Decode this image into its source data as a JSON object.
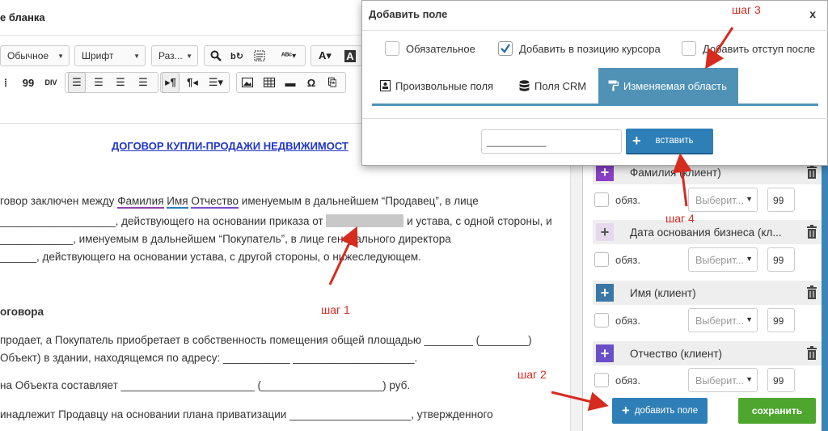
{
  "editor": {
    "title": "е бланка",
    "toolbar": {
      "style_select": "Обычное",
      "font_select": "Шрифт",
      "size_select": "Раз..."
    },
    "document": {
      "heading": "ДОГОВОР КУПЛИ-ПРОДАЖИ НЕДВИЖИМОСТ",
      "l1_a": "говор заключен между ",
      "l1_f1": "Фамилия",
      "l1_f2": "Имя",
      "l1_f3": "Отчество",
      "l1_b": " именуемым в дальнейшем “Продавец”, в лице",
      "l2_a": "___________________, действующего на основании приказа от ",
      "l2_b": " и устава, с одной стороны, и",
      "l3": "____________, именуемым в дальнейшем “Покупатель”, в лице генерального директора",
      "l4": "______, действующего на основании устава, с другой стороны, о нижеследующем.",
      "sec1": "оговора",
      "l5": "продает, а Покупатель приобретает в собственность помещения общей площадью ________ (________)",
      "l6": "Объект) в здании, находящемся по адресу: ___________ ____________________.",
      "l7": "на Объекта составляет ______________________ (____________________) руб.",
      "l8": "инадлежит Продавцу на основании плана приватизации ____________________, утвержденного"
    }
  },
  "annotations": {
    "step1": "шаг 1",
    "step2": "шаг 2",
    "step3": "шаг 3",
    "step4": "шаг 4"
  },
  "dialog": {
    "title": "Добавить поле",
    "close": "x",
    "options": [
      {
        "label": "Обязательное",
        "checked": false
      },
      {
        "label": "Добавить в позицию курсора",
        "checked": true
      },
      {
        "label": "Добавить отступ после",
        "checked": false
      }
    ],
    "tabs": [
      "Произвольные поля",
      "Поля CRM",
      "Изменяемая область"
    ],
    "active_tab": "Изменяемая область",
    "input_value": "___________",
    "insert_button": "вставить"
  },
  "fields_panel": {
    "fields": [
      {
        "label": "Фамилия (клиент)",
        "required": "обяз.",
        "select": "Выберит...",
        "order": "99",
        "color": "#8a3fc7"
      },
      {
        "label": "Дата основания бизнеса (кл...",
        "required": "обяз.",
        "select": "Выберит...",
        "order": "99",
        "color": "#e6d9ec"
      },
      {
        "label": "Имя (клиент)",
        "required": "обяз.",
        "select": "Выберит...",
        "order": "99",
        "color": "#3b77a6"
      },
      {
        "label": "Отчество (клиент)",
        "required": "обяз.",
        "select": "Выберит...",
        "order": "99",
        "color": "#6b4fc8"
      }
    ],
    "add_button": "добавить поле",
    "save_button": "сохранить"
  },
  "colors": {
    "accent_blue": "#2e7fb8",
    "tab_active": "#4f92b6",
    "save_green": "#4fa62e",
    "annotation_red": "#d62b1f",
    "heading_link": "#1f36c7"
  }
}
